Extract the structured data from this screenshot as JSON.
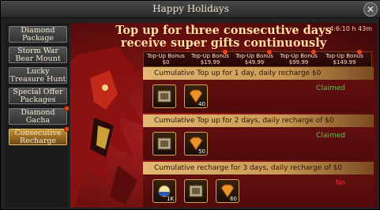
{
  "window": {
    "title": "Happy Holidays"
  },
  "sidebar": {
    "items": [
      {
        "label": "Diamond Package",
        "badge": false
      },
      {
        "label": "Storm War Bear Mount",
        "badge": false
      },
      {
        "label": "Lucky Treasure Hunt",
        "badge": false
      },
      {
        "label": "Special Offer Packages",
        "badge": false
      },
      {
        "label": "Diamond Gacha",
        "badge": true
      },
      {
        "label": "Consecutive Recharge",
        "badge": true,
        "active": true
      }
    ]
  },
  "main": {
    "headline_line1": "Top up for three consecutive days",
    "headline_line2": "receive super gifts continuously",
    "timer": "4:6:10 h 43m"
  },
  "bonuses": [
    {
      "label": "Top-Up Bonus",
      "amount": "$0"
    },
    {
      "label": "Top-Up Bonus",
      "amount": "$19.99"
    },
    {
      "label": "Top-Up Bonus",
      "amount": "$49.99"
    },
    {
      "label": "Top-Up Bonus",
      "amount": "$99.99"
    },
    {
      "label": "Top-Up Bonus",
      "amount": "$149.99"
    }
  ],
  "tasks": [
    {
      "title": "Cumulative Top up for 1 day, daily recharge $0",
      "status": "Claimed",
      "rewards": [
        {
          "icon": "scroll-icon",
          "qty": ""
        },
        {
          "icon": "gem-icon",
          "qty": "40"
        }
      ]
    },
    {
      "title": "Cumulative Top up for 2 days, daily recharge of $0",
      "status": "Claimed",
      "rewards": [
        {
          "icon": "scroll-icon",
          "qty": ""
        },
        {
          "icon": "gem-icon",
          "qty": "50"
        }
      ]
    },
    {
      "title": "Cumulative recharge for 3 days, daily recharge of $0",
      "status": "No",
      "rewards": [
        {
          "icon": "potion-icon",
          "qty": "1K"
        },
        {
          "icon": "scroll-icon",
          "qty": ""
        },
        {
          "icon": "gem-icon",
          "qty": "60"
        }
      ]
    }
  ]
}
